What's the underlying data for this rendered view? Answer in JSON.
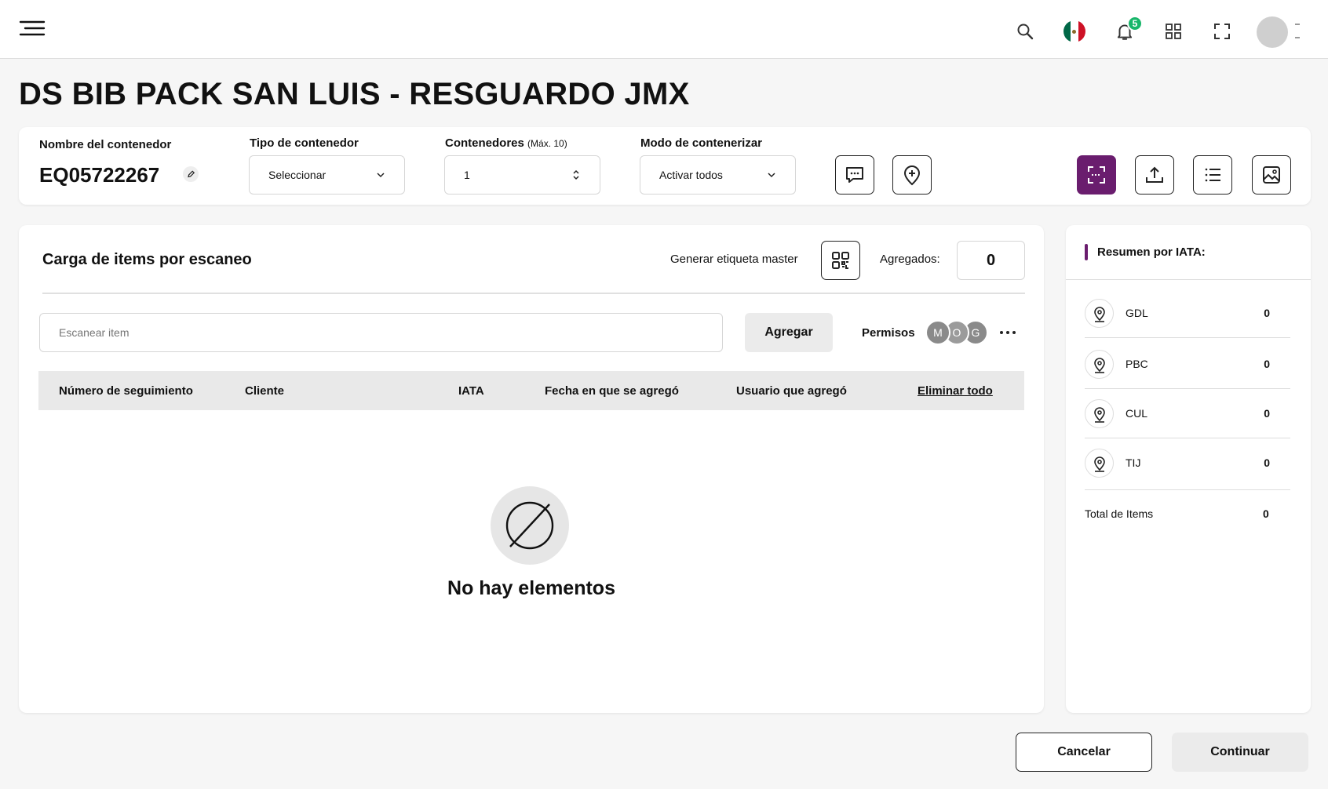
{
  "header": {
    "notification_count": "5",
    "flag_colors": [
      "#006847",
      "#ffffff",
      "#ce1126"
    ],
    "icons": [
      "menu-icon",
      "search-icon",
      "mexico-flag-icon",
      "bell-icon",
      "grid-icon",
      "fullscreen-icon"
    ]
  },
  "page": {
    "title": "DS BIB PACK SAN LUIS - RESGUARDO JMX"
  },
  "container": {
    "name_label": "Nombre del contenedor",
    "name_value": "EQ05722267",
    "type_label": "Tipo de contenedor",
    "type_value": "Seleccionar",
    "count_label": "Contenedores",
    "count_hint": "(Máx. 10)",
    "count_value": "1",
    "mode_label": "Modo de contenerizar",
    "mode_value": "Activar todos"
  },
  "scan": {
    "title": "Carga de items por escaneo",
    "master_label": "Generar etiqueta master",
    "added_label": "Agregados:",
    "added_value": "0",
    "input_placeholder": "Escanear item",
    "add_button": "Agregar",
    "permissions_label": "Permisos",
    "permission_avatars": [
      "M",
      "O",
      "G"
    ]
  },
  "table": {
    "columns": [
      "Número de seguimiento",
      "Cliente",
      "IATA",
      "Fecha en que se agregó",
      "Usuario que agregó"
    ],
    "delete_all": "Eliminar todo",
    "empty_text": "No hay elementos"
  },
  "summary": {
    "title": "Resumen por IATA:",
    "rows": [
      {
        "code": "GDL",
        "value": "0"
      },
      {
        "code": "PBC",
        "value": "0"
      },
      {
        "code": "CUL",
        "value": "0"
      },
      {
        "code": "TIJ",
        "value": "0"
      }
    ],
    "total_label": "Total de Items",
    "total_value": "0"
  },
  "footer": {
    "cancel": "Cancelar",
    "continue": "Continuar"
  },
  "colors": {
    "accent": "#6a1d6e",
    "badge": "#18b66a",
    "header_row": "#e9e9e9"
  }
}
